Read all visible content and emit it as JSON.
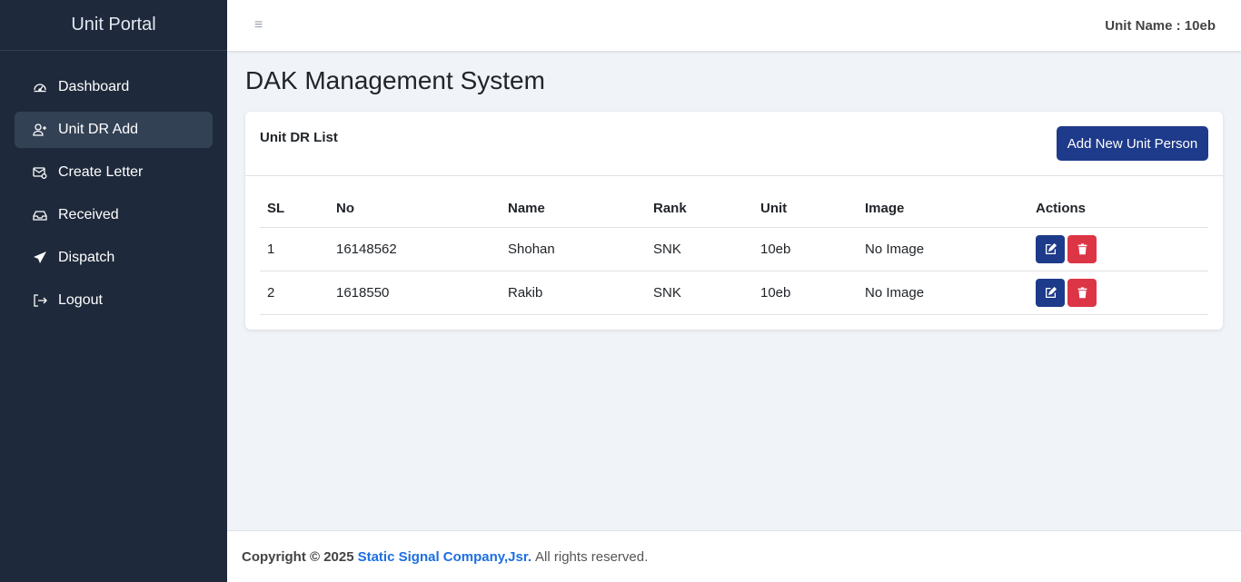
{
  "sidebar": {
    "brand": "Unit Portal",
    "items": [
      {
        "label": "Dashboard",
        "icon": "gauge-icon"
      },
      {
        "label": "Unit DR Add",
        "icon": "user-plus-icon",
        "active": true
      },
      {
        "label": "Create Letter",
        "icon": "envelope-gear-icon"
      },
      {
        "label": "Received",
        "icon": "inbox-icon"
      },
      {
        "label": "Dispatch",
        "icon": "paper-plane-icon"
      },
      {
        "label": "Logout",
        "icon": "logout-icon"
      }
    ]
  },
  "topbar": {
    "menu_icon": "≡",
    "unit_name": "Unit Name : 10eb"
  },
  "main": {
    "title": "DAK Management System",
    "card_title": "Unit DR List",
    "add_button": "Add New Unit Person",
    "table": {
      "headers": [
        "SL",
        "No",
        "Name",
        "Rank",
        "Unit",
        "Image",
        "Actions"
      ],
      "rows": [
        [
          "1",
          "16148562",
          "Shohan",
          "SNK",
          "10eb",
          "No Image"
        ],
        [
          "2",
          "1618550",
          "Rakib",
          "SNK",
          "10eb",
          "No Image"
        ]
      ]
    }
  },
  "footer": {
    "prefix": "Copyright © 2025",
    "company": "Static Signal Company,Jsr.",
    "suffix": "All rights reserved."
  },
  "colors": {
    "sidebar_bg": "#1e293b",
    "primary": "#1e3a8a",
    "danger": "#dc3545",
    "link": "#1d6fe0"
  }
}
